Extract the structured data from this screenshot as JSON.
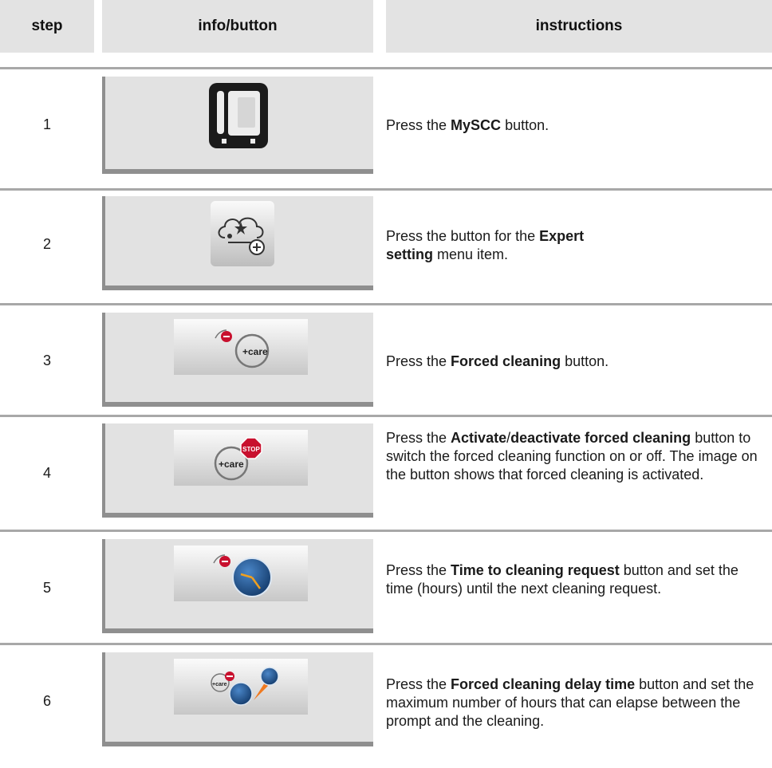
{
  "header": {
    "col_step": "step",
    "col_info": "info/button",
    "col_instructions": "instructions"
  },
  "rows": [
    {
      "step": "1",
      "icon": "mysccc-oven-icon",
      "pre": "Press the ",
      "bold": "MySCC",
      "mid": "",
      "bold2": "",
      "post": " button."
    },
    {
      "step": "2",
      "icon": "expert-setting-icon",
      "pre": "Press the button for the ",
      "bold": "Expert setting",
      "mid": "",
      "bold2": "",
      "post": " menu item."
    },
    {
      "step": "3",
      "icon": "forced-cleaning-icon",
      "pre": "Press the ",
      "bold": "Forced cleaning",
      "mid": "",
      "bold2": "",
      "post": " button."
    },
    {
      "step": "4",
      "icon": "activate-deactivate-forced-cleaning-icon",
      "pre": "Press the ",
      "bold": "Activate",
      "mid": "/",
      "bold2": "deactivate forced cleaning",
      "post": " button to switch the forced cleaning function on or off. The image on the button shows that forced cleaning is activated."
    },
    {
      "step": "5",
      "icon": "time-to-cleaning-request-icon",
      "pre": "Press the ",
      "bold": "Time to cleaning request",
      "mid": "",
      "bold2": "",
      "post": " button and set the time (hours) until the next cleaning request."
    },
    {
      "step": "6",
      "icon": "forced-cleaning-delay-time-icon",
      "pre": "Press the ",
      "bold": "Forced cleaning delay time",
      "mid": "",
      "bold2": "",
      "post": " button and set the maximum number of hours that can elapse between the prompt and the cleaning."
    }
  ],
  "icon_text": {
    "care": "+care",
    "stop": "STOP"
  },
  "colors": {
    "header_bg": "#e3e3e3",
    "rule": "#a8a8a8",
    "button_bg": "#e2e2e2",
    "frame": "#8f8f8f",
    "stop_red": "#c8102e",
    "clock_blue": "#1f4f8a"
  }
}
